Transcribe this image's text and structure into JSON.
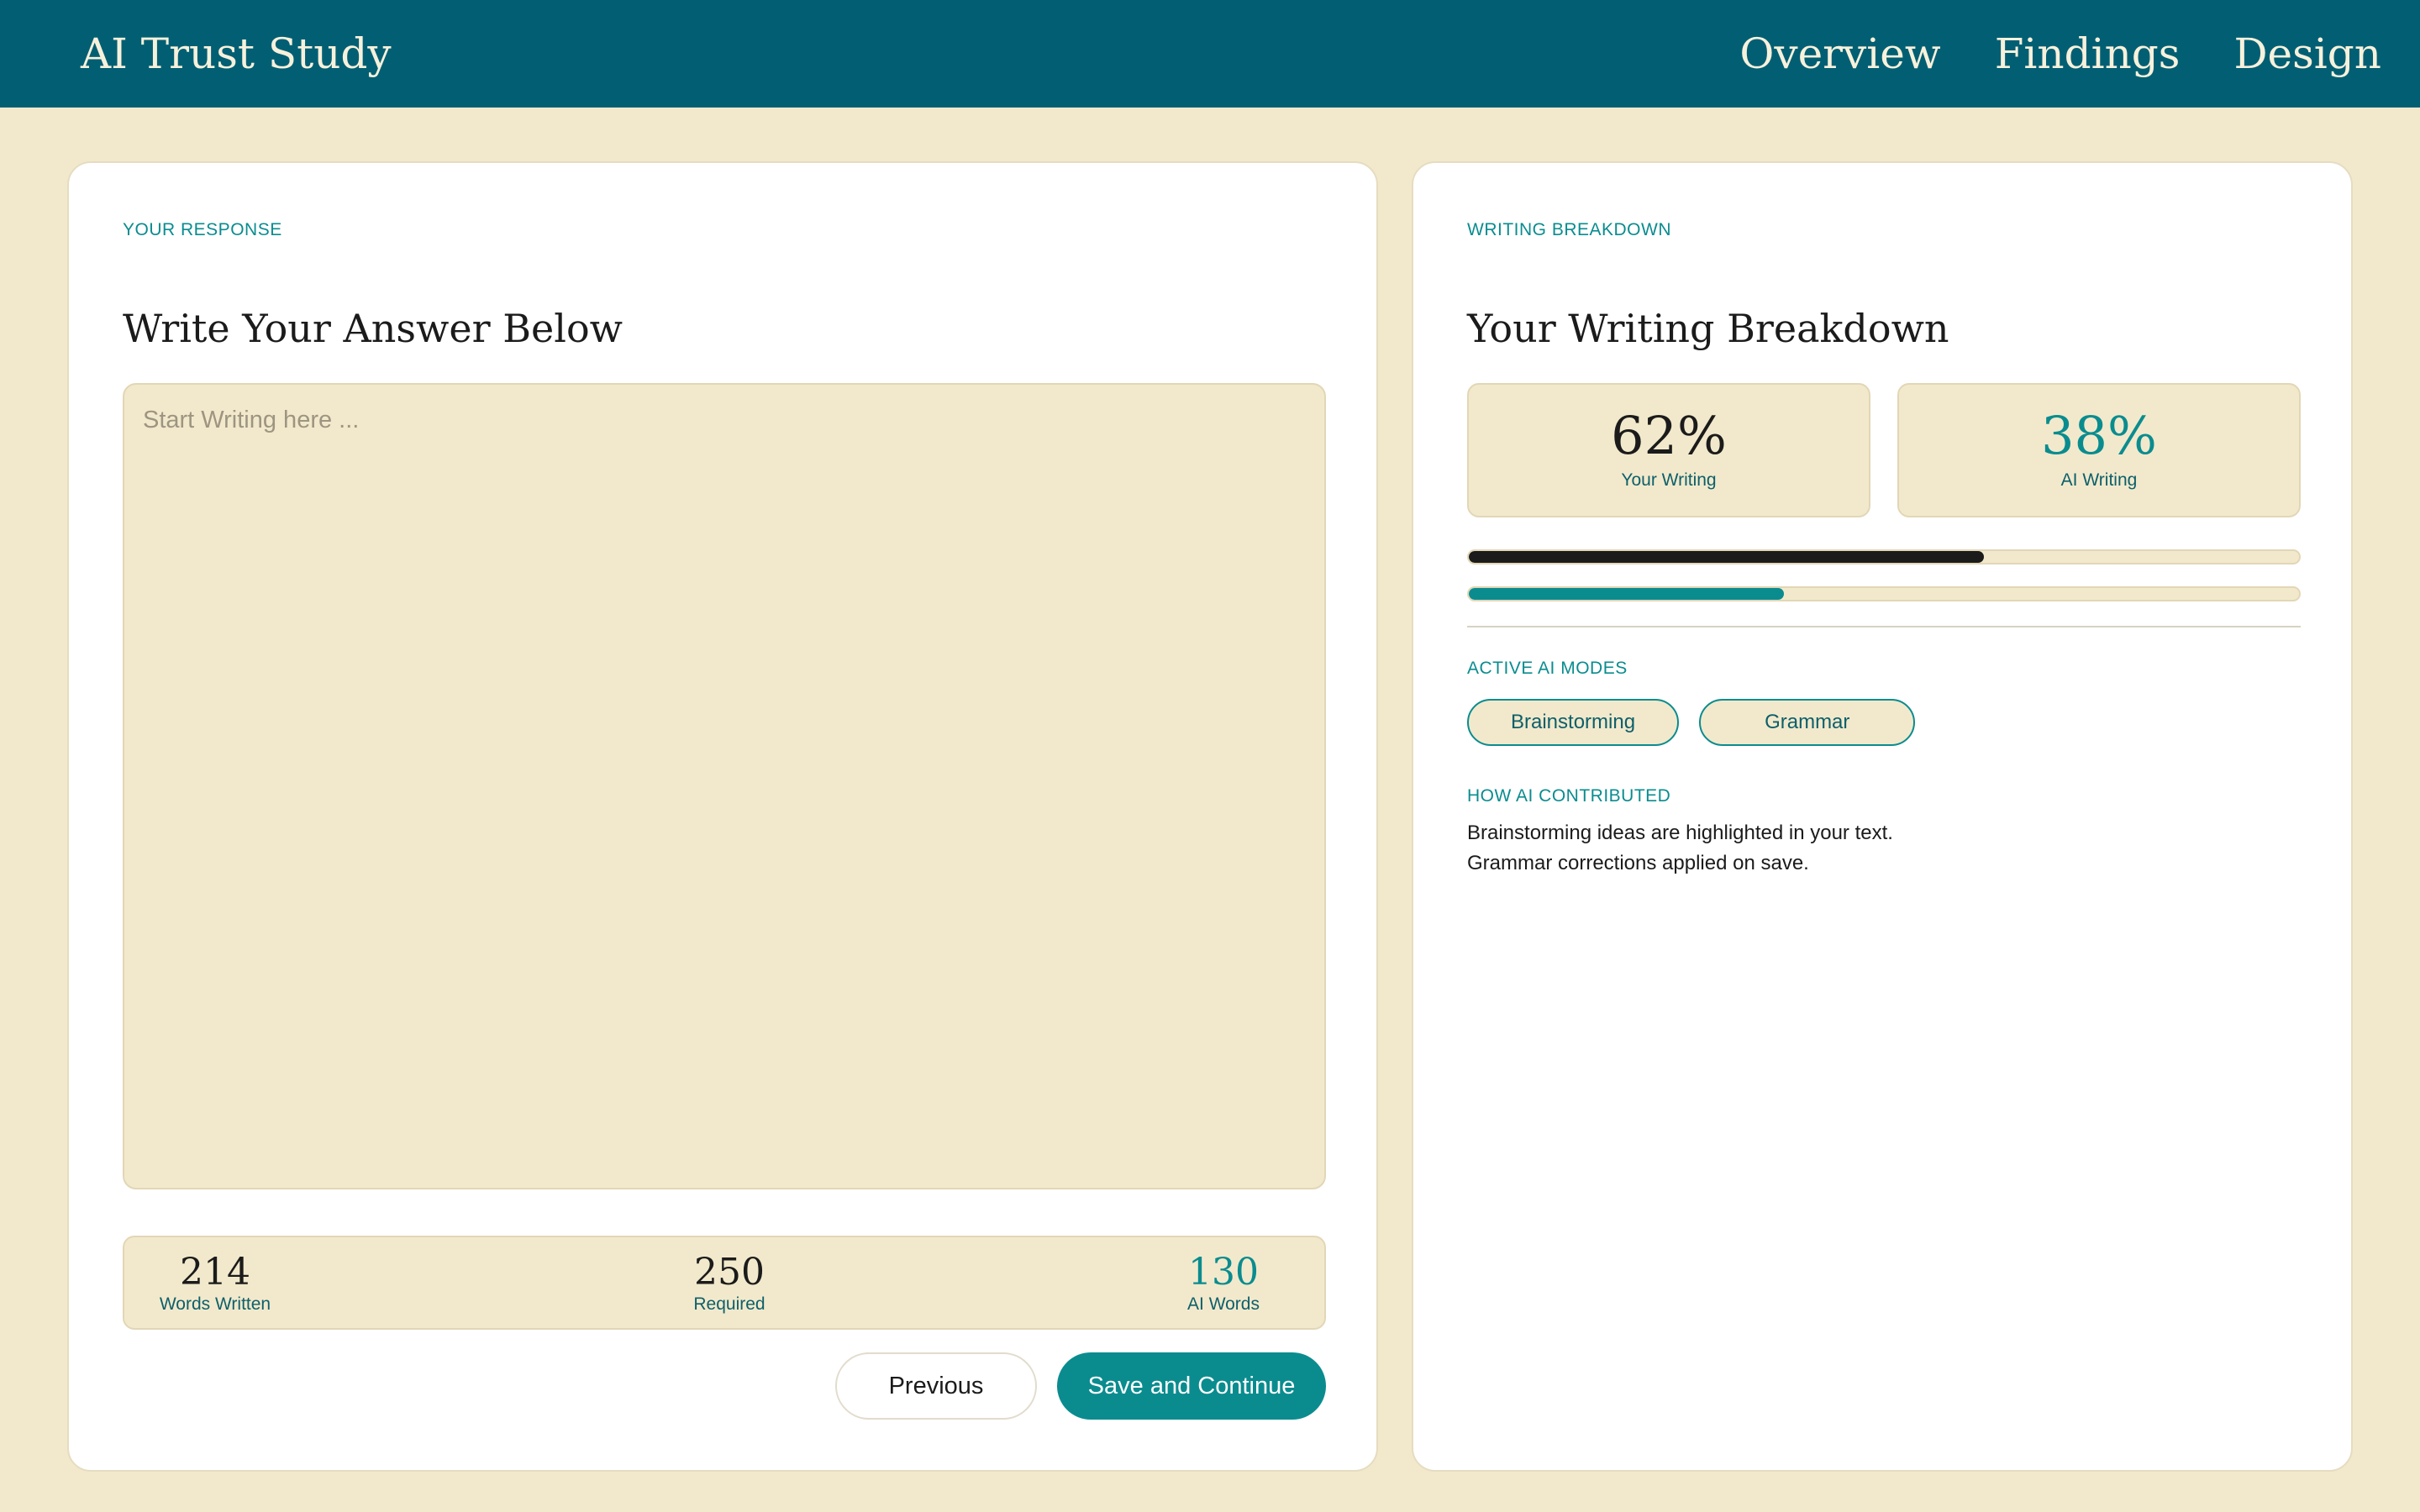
{
  "header": {
    "brand": "AI Trust Study",
    "nav": [
      "Overview",
      "Findings",
      "Design"
    ]
  },
  "response": {
    "eyebrow": "YOUR RESPONSE",
    "title": "Write Your Answer Below",
    "placeholder": "Start Writing here ...",
    "counts": {
      "written": {
        "value": "214",
        "label": "Words Written"
      },
      "required": {
        "value": "250",
        "label": "Required"
      },
      "ai": {
        "value": "130",
        "label": "AI Words"
      }
    },
    "buttons": {
      "previous": "Previous",
      "save": "Save and Continue"
    }
  },
  "breakdown": {
    "eyebrow": "WRITING  BREAKDOWN",
    "title": "Your Writing Breakdown",
    "your_writing": {
      "value": "62%",
      "label": "Your Writing",
      "fraction": 0.62
    },
    "ai_writing": {
      "value": "38%",
      "label": "AI Writing",
      "fraction": 0.38
    },
    "modes_label": "ACTIVE AI MODES",
    "modes": [
      "Brainstorming",
      "Grammar"
    ],
    "contrib_label": "HOW AI CONTRIBUTED",
    "contrib_lines": [
      "Brainstorming ideas are highlighted in your text.",
      "Grammar corrections applied on save."
    ]
  },
  "colors": {
    "header": "#025f73",
    "accent": "#0a8c8f",
    "background": "#f2e9cc",
    "dark_bar": "#1b1b1b"
  }
}
